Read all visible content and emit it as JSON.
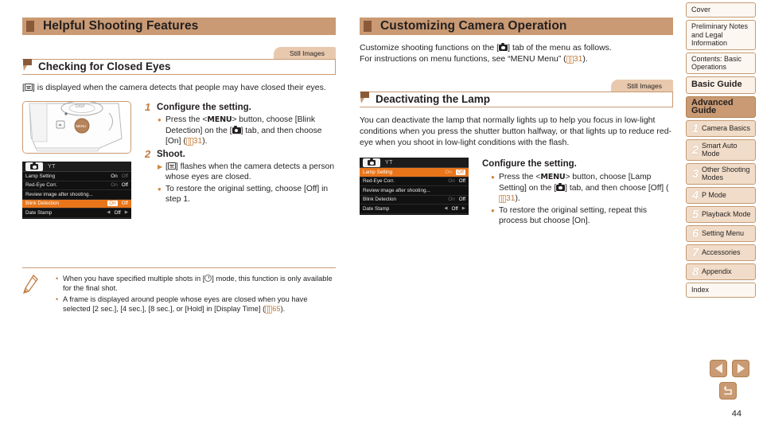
{
  "left_column": {
    "chapter_title": "Helpful Shooting Features",
    "still_images_tab": "Still Images",
    "section_title": "Checking for Closed Eyes",
    "intro_prefix": "[",
    "intro_text": "] is displayed when the camera detects that people may have closed their eyes.",
    "menu_shot": {
      "tab_camera_icon": "camera-tab-icon",
      "tab_wrench": "YT",
      "rows": [
        {
          "label": "Lamp Setting",
          "val_a": "On",
          "val_b": "Off",
          "state": "a-white-b-dim",
          "selected": false
        },
        {
          "label": "Red-Eye Corr.",
          "val_a": "On",
          "val_b": "Off",
          "state": "a-dim-b-white",
          "selected": false
        },
        {
          "label": "Review image after shooting...",
          "val_a": "",
          "val_b": "",
          "state": "none",
          "selected": false
        },
        {
          "label": "Blink Detection",
          "val_a": "On",
          "val_b": "Off",
          "state": "a-hot-b-plain",
          "selected": true
        },
        {
          "label": "Date Stamp",
          "val_a": "Off",
          "val_b": "",
          "state": "arrows",
          "selected": false
        }
      ]
    },
    "steps": [
      {
        "number": "1",
        "title": "Configure the setting.",
        "bullets": [
          {
            "marker": "dot",
            "text_parts": [
              "Press the <",
              "MENU",
              "> button, choose [Blink Detection] on the [",
              "camera-icon",
              "] tab, and then choose [On] (",
              "31",
              ")."
            ]
          }
        ]
      },
      {
        "number": "2",
        "title": "Shoot.",
        "bullets": [
          {
            "marker": "triangle",
            "text_parts": [
              "[",
              "blink-icon",
              "] flashes when the camera detects a person whose eyes are closed."
            ]
          },
          {
            "marker": "dot",
            "text_parts": [
              "To restore the original setting, choose [Off] in step 1."
            ]
          }
        ]
      }
    ],
    "note": {
      "icon": "pencil-icon",
      "items": [
        {
          "parts": [
            "When you have specified multiple shots in [",
            "timer-icon",
            "] mode, this function is only available for the final shot."
          ]
        },
        {
          "parts": [
            "A frame is displayed around people whose eyes are closed when you have selected [2 sec.], [4 sec.], [8 sec.], or [Hold] in [Display Time] (",
            "65",
            ")."
          ]
        }
      ]
    }
  },
  "right_column": {
    "chapter_title": "Customizing Camera Operation",
    "intro_line1_a": "Customize shooting functions on the [",
    "intro_line1_b": "] tab of the menu as follows.",
    "intro_line2_a": "For instructions on menu functions, see “MENU Menu” (",
    "intro_line2_page": "31",
    "intro_line2_b": ").",
    "still_images_tab": "Still Images",
    "section_title": "Deactivating the Lamp",
    "body_text": "You can deactivate the lamp that normally lights up to help you focus in low-light conditions when you press the shutter button halfway, or that lights up to reduce red-eye when you shoot in low-light conditions with the flash.",
    "menu_shot": {
      "tab_wrench": "YT",
      "rows": [
        {
          "label": "Lamp Setting",
          "val_a": "On",
          "val_b": "Off",
          "state": "a-dim-b-hot",
          "selected": true
        },
        {
          "label": "Red-Eye Corr.",
          "val_a": "On",
          "val_b": "Off",
          "state": "a-dim-b-white",
          "selected": false
        },
        {
          "label": "Review image after shooting...",
          "val_a": "",
          "val_b": "",
          "state": "none",
          "selected": false
        },
        {
          "label": "Blink Detection",
          "val_a": "On",
          "val_b": "Off",
          "state": "a-dim-b-white",
          "selected": false
        },
        {
          "label": "Date Stamp",
          "val_a": "Off",
          "val_b": "",
          "state": "arrows",
          "selected": false
        }
      ]
    },
    "step_title": "Configure the setting.",
    "bullets": [
      {
        "marker": "dot",
        "text_parts": [
          "Press the <",
          "MENU",
          "> button, choose [Lamp Setting] on the [",
          "camera-icon",
          "] tab, and then choose [Off] (",
          "31",
          ")."
        ]
      },
      {
        "marker": "dot",
        "text_parts": [
          "To restore the original setting, repeat this process but choose [On]."
        ]
      }
    ]
  },
  "sidebar": {
    "items": [
      {
        "label": "Cover",
        "num": "",
        "kind": "plain"
      },
      {
        "label": "Preliminary Notes and Legal Information",
        "num": "",
        "kind": "plain"
      },
      {
        "label": "Contents: Basic Operations",
        "num": "",
        "kind": "plain"
      },
      {
        "label": "Basic Guide",
        "num": "",
        "kind": "big"
      },
      {
        "label": "Advanced Guide",
        "num": "",
        "kind": "adv"
      },
      {
        "label": "Camera Basics",
        "num": "1",
        "kind": "chap"
      },
      {
        "label": "Smart Auto Mode",
        "num": "2",
        "kind": "chap"
      },
      {
        "label": "Other Shooting Modes",
        "num": "3",
        "kind": "chap"
      },
      {
        "label": "P Mode",
        "num": "4",
        "kind": "chap"
      },
      {
        "label": "Playback Mode",
        "num": "5",
        "kind": "chap"
      },
      {
        "label": "Setting Menu",
        "num": "6",
        "kind": "chap"
      },
      {
        "label": "Accessories",
        "num": "7",
        "kind": "chap"
      },
      {
        "label": "Appendix",
        "num": "8",
        "kind": "chap"
      },
      {
        "label": "Index",
        "num": "",
        "kind": "plain"
      }
    ]
  },
  "nav": {
    "prev_icon": "triangle-left-icon",
    "next_icon": "triangle-right-icon",
    "back_icon": "return-arrow-icon",
    "page_number": "44"
  },
  "colors": {
    "accent_tan": "#c99a73",
    "accent_brown": "#8a5a38",
    "orange_highlight": "#e8751a",
    "link_orange": "#c07a3e",
    "sidebar_fill": "#fbf1e7"
  }
}
